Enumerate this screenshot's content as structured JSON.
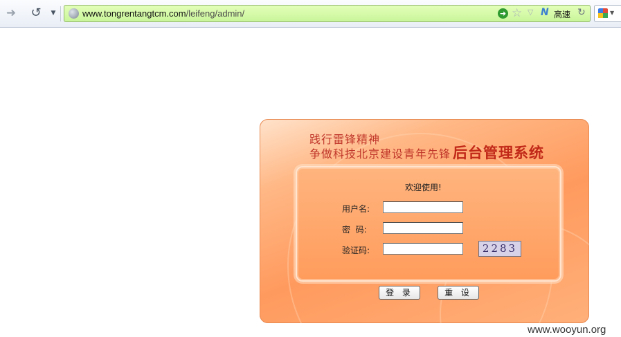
{
  "browser": {
    "url_host": "www.tongrentangtcm.com",
    "url_path": "/leifeng/admin/",
    "speed_label": "高速"
  },
  "icons": {
    "forward": "forward-arrow-icon",
    "reload": "reload-icon",
    "go": "go-arrow-icon",
    "bookmark": "star-icon",
    "search_engine": "google-icon"
  },
  "header": {
    "slogan_line1": "践行雷锋精神",
    "slogan_line2": "争做科技北京建设青年先锋",
    "system_title": "后台管理系统"
  },
  "login": {
    "welcome": "欢迎使用!",
    "username_label": "用户名:",
    "password_label": "密  码:",
    "captcha_label": "验证码:",
    "username_value": "",
    "password_value": "",
    "captcha_input_value": "",
    "captcha_image_text": "2283",
    "login_button": "登 录",
    "reset_button": "重 设"
  },
  "watermark": "www.wooyun.org",
  "colors": {
    "urlbar_bg": "#c9f59b",
    "panel_orange": "#ff9a5e",
    "title_red": "#c12818"
  }
}
